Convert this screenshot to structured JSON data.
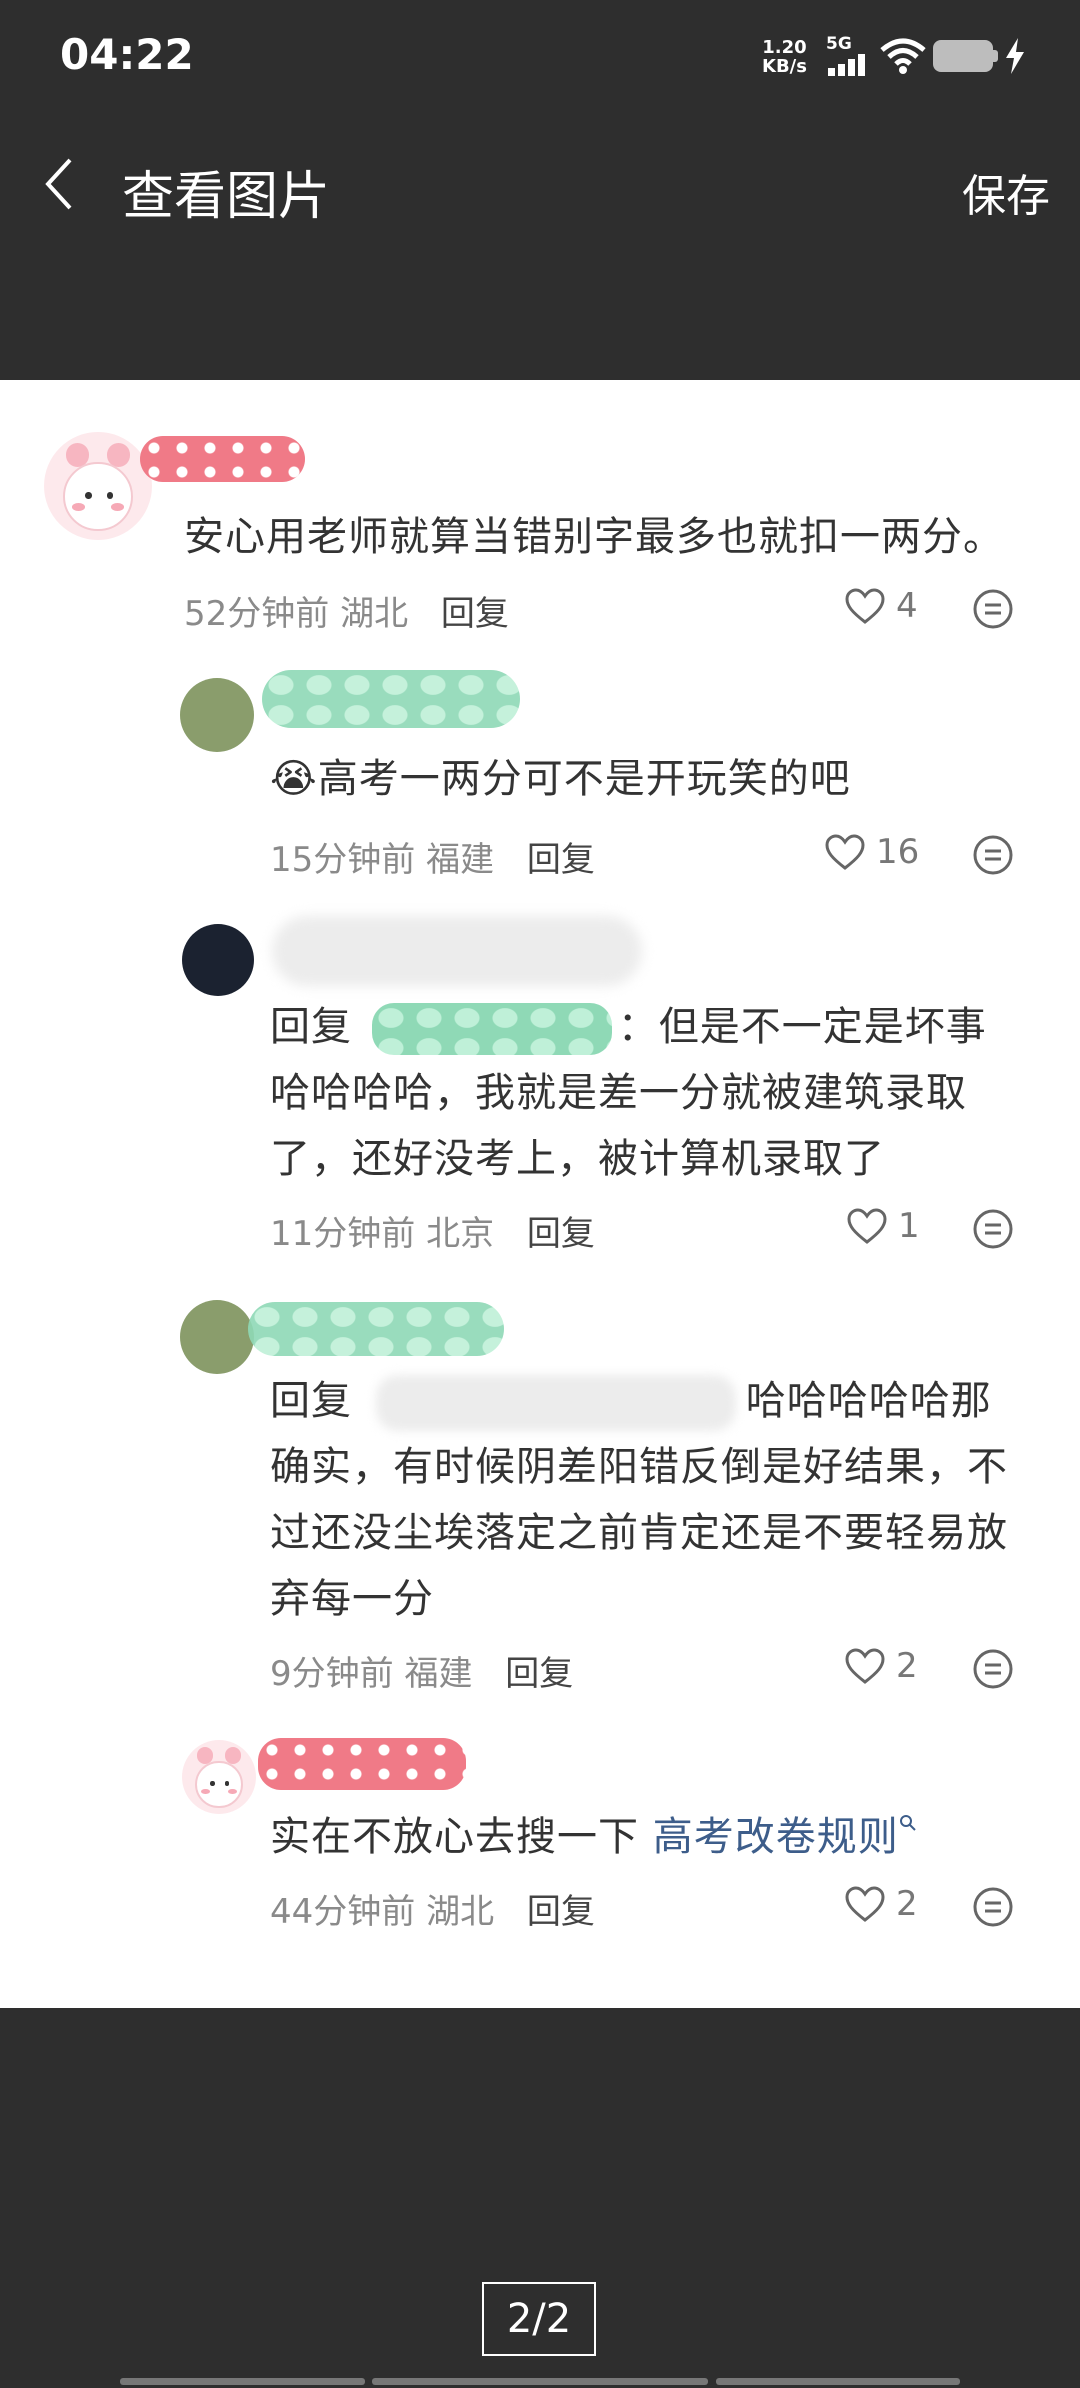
{
  "status_bar": {
    "time": "04:22",
    "net_speed_value": "1.20",
    "net_speed_unit": "KB/s",
    "network": "5G"
  },
  "header": {
    "title": "查看图片",
    "save_label": "保存"
  },
  "comments": [
    {
      "text": "安心用老师就算当错别字最多也就扣一两分。",
      "time": "52分钟前",
      "location": "湖北",
      "reply_label": "回复",
      "likes": "4"
    },
    {
      "text": "高考一两分可不是开玩笑的吧",
      "time": "15分钟前",
      "location": "福建",
      "reply_label": "回复",
      "likes": "16"
    },
    {
      "prefix": "回复",
      "separator": "：",
      "text_line1": "但是不一定是坏事",
      "text_line2": "哈哈哈哈，我就是差一分就被建筑录取",
      "text_line3": "了，还好没考上，被计算机录取了",
      "time": "11分钟前",
      "location": "北京",
      "reply_label": "回复",
      "likes": "1"
    },
    {
      "prefix": "回复",
      "text_line1": "哈哈哈哈哈那",
      "text_line2": "确实，有时候阴差阳错反倒是好结果，不",
      "text_line3": "过还没尘埃落定之前肯定还是不要轻易放",
      "text_line4": "弃每一分",
      "time": "9分钟前",
      "location": "福建",
      "reply_label": "回复",
      "likes": "2"
    },
    {
      "text": "实在不放心去搜一下",
      "link": "高考改卷规则",
      "time": "44分钟前",
      "location": "湖北",
      "reply_label": "回复",
      "likes": "2"
    }
  ],
  "pager": {
    "label": "2/2"
  }
}
